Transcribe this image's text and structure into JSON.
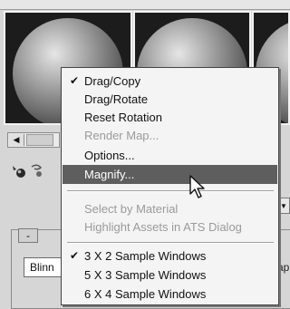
{
  "menu": {
    "items": [
      {
        "label": "Drag/Copy",
        "checked": true,
        "disabled": false
      },
      {
        "label": "Drag/Rotate",
        "checked": false,
        "disabled": false
      },
      {
        "label": "Reset Rotation",
        "checked": false,
        "disabled": false
      },
      {
        "label": "Render Map...",
        "checked": false,
        "disabled": true
      },
      {
        "label": "Options...",
        "checked": false,
        "disabled": false
      },
      {
        "label": "Magnify...",
        "checked": false,
        "disabled": false,
        "highlighted": true
      },
      {
        "label": "Select by Material",
        "checked": false,
        "disabled": true
      },
      {
        "label": "Highlight Assets in ATS Dialog",
        "checked": false,
        "disabled": true
      },
      {
        "label": "3 X 2 Sample Windows",
        "checked": true,
        "disabled": false
      },
      {
        "label": "5 X 3 Sample Windows",
        "checked": false,
        "disabled": false
      },
      {
        "label": "6 X 4 Sample Windows",
        "checked": false,
        "disabled": false
      }
    ],
    "check_glyph": "✔"
  },
  "panel": {
    "rollout_toggle": "-",
    "shader_value": "Blinn",
    "right_fragment": "ap"
  },
  "icons": {
    "scroll_left": "◀",
    "dropdown": "▼"
  },
  "colors": {
    "menu_background": "#f4f4f4",
    "highlight": "#5e5e5e",
    "disabled_text": "#9a9a9a"
  }
}
